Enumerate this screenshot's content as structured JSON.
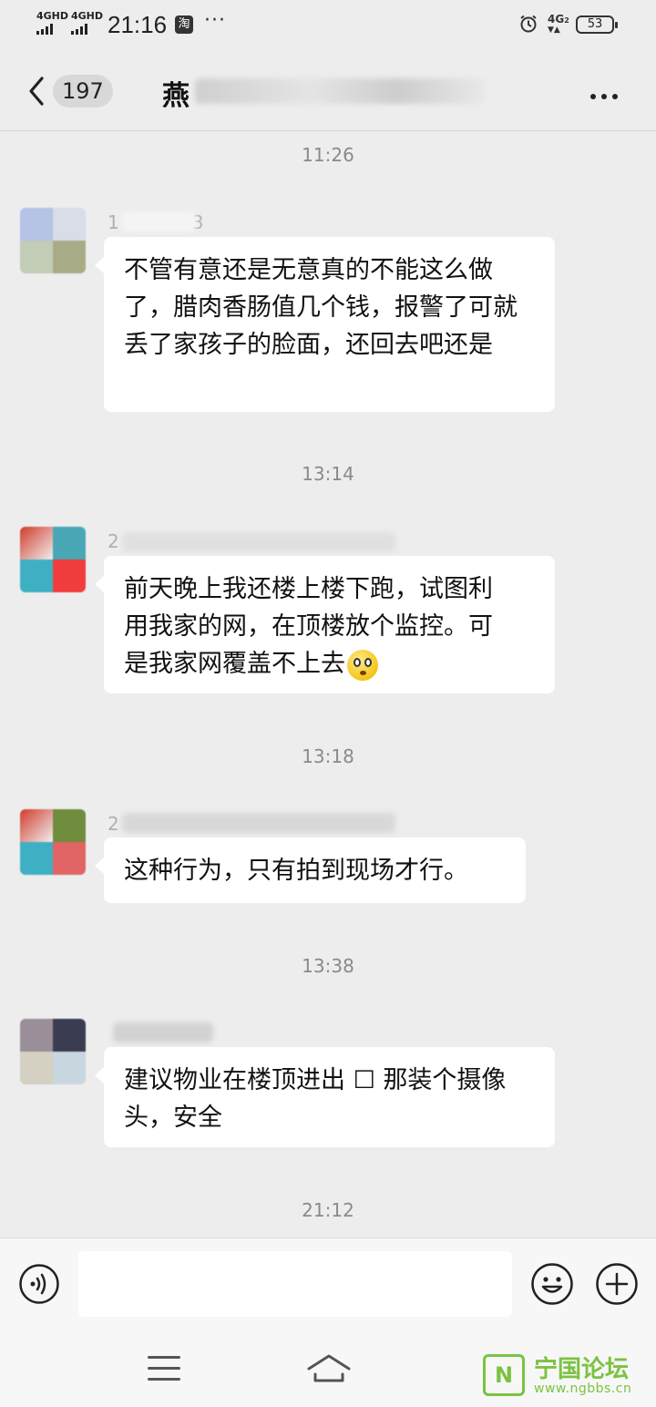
{
  "status_bar": {
    "sim1": "4GHD",
    "sim2": "4GHD",
    "time": "21:16",
    "app_badge": "淘",
    "more": "···",
    "network": "4G",
    "network_sub": "2",
    "battery": "53"
  },
  "header": {
    "unread_count": "197",
    "title_visible": "燕"
  },
  "messages": [
    {
      "timestamp": "11:26",
      "sender": "1",
      "sender_tail": "3",
      "text": "不管有意还是无意真的不能这么做了，腊肉香肠值几个钱，报警了可就丢了家孩子的脸面，还回去吧还是"
    },
    {
      "timestamp": "13:14",
      "sender": "2",
      "text_line1": "前天晚上我还楼上楼下跑，试图利",
      "text_line2": "用我家的网，在顶楼放个监控。可",
      "text_line3": "是我家网覆盖不上去"
    },
    {
      "timestamp": "13:18",
      "sender": "2",
      "text": "这种行为，只有拍到现场才行。"
    },
    {
      "timestamp": "13:38",
      "sender": "",
      "text": "建议物业在楼顶进出 ☐ 那装个摄像头，安全"
    },
    {
      "timestamp": "21:12"
    }
  ],
  "watermark": {
    "name": "宁国论坛",
    "url": "www.ngbbs.cn",
    "logo_char": "N"
  },
  "icons": [
    "back-icon",
    "more-icon",
    "voice-icon",
    "emoji-icon",
    "plus-icon",
    "menu-icon",
    "home-icon",
    "alarm-icon"
  ]
}
